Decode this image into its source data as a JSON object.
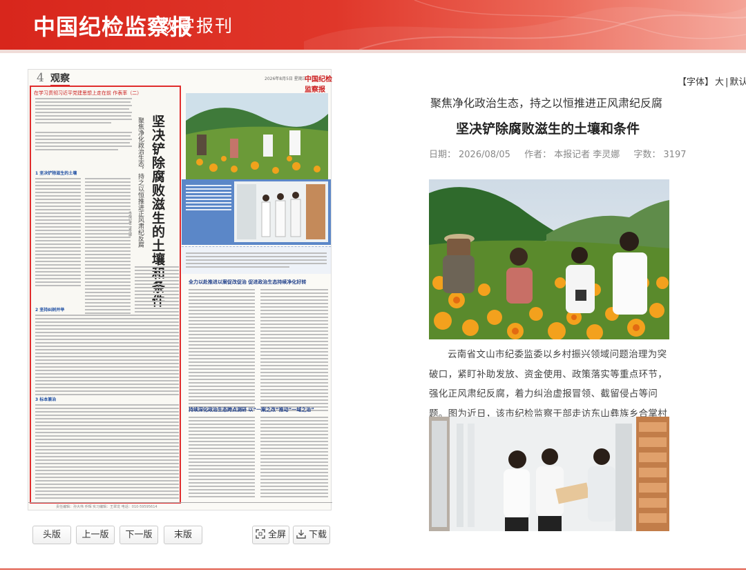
{
  "header": {
    "logo": "中国纪检监察报",
    "subtitle": "数字报刊"
  },
  "newspaper_page": {
    "page_number": "4",
    "section": "观察",
    "date_line": "2026年8月5日 星期三",
    "brand": "中国纪检监察报",
    "column_banner": "在学习贯彻习近平党建思想上走在前 作表率（二）",
    "headline": "坚决铲除腐败滋生的土壤和条件",
    "subheadline": "聚焦净化政治生态，持之以恒推进正风肃纪反腐",
    "byline": "本报记者 李灵娜",
    "section_tags": [
      "1 坚决铲除滋生的土壤",
      "2 坚持纠树并举",
      "3 标本兼治"
    ],
    "sub_headline_1": "全力以赴推进以案促改促治 促进政治生态持续净化好转",
    "sub_headline_2": "持续深化政治生态跨点测研 以“一案之改”推动“一域之治”",
    "footer": "责任编辑：孙大伟 乔辉 实习编辑：王翠龙 电话：010-59595614"
  },
  "nav_buttons": {
    "first": "头版",
    "prev": "上一版",
    "next": "下一版",
    "last": "末版",
    "fullscreen": "全屏",
    "download": "下载"
  },
  "font_control": {
    "label": "【字体】",
    "large": "大",
    "sep": "|",
    "default": "默认",
    "small": "|"
  },
  "article": {
    "kicker": "聚焦净化政治生态，持之以恒推进正风肃纪反腐",
    "title": "坚决铲除腐败滋生的土壤和条件",
    "date_label": "日期：",
    "date": "2026/08/05",
    "author_label": "作者：",
    "author": "本报记者 李灵娜",
    "words_label": "字数：",
    "words": "3197",
    "caption": "云南省文山市纪委监委以乡村振兴领域问题治理为突破口，紧盯补助发放、资金使用、政策落实等重点环节，强化正风肃纪反腐，着力纠治虚报冒领、截留侵占等问题。图为近日，该市纪检监察干部走访东山彝族乡合掌村了解有关情况。王铭坚 摄"
  },
  "colors": {
    "brand_red": "#d8261c",
    "highlight_border": "#e02b2b"
  }
}
